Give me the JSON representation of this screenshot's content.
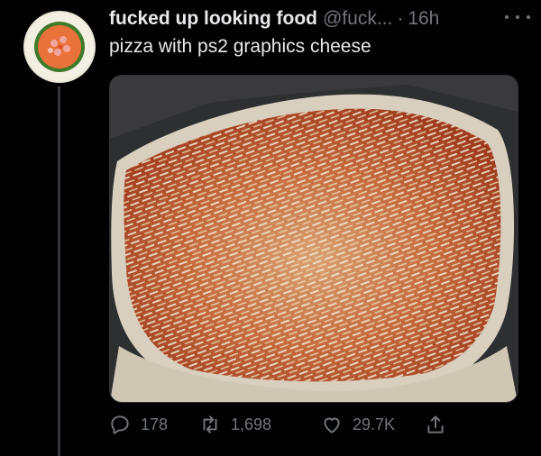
{
  "tweet": {
    "display_name": "fucked up looking food",
    "handle": "@fuck...",
    "separator": "·",
    "time": "16h",
    "text": "pizza with ps2 graphics cheese",
    "more_icon": "ellipsis-icon",
    "avatar_image": "plate-of-food",
    "media_image": "pizza-photo"
  },
  "actions": {
    "replies": "178",
    "retweets": "1,698",
    "likes": "29.7K",
    "reply_icon": "reply-icon",
    "retweet_icon": "retweet-icon",
    "like_icon": "heart-icon",
    "share_icon": "share-icon"
  },
  "colors": {
    "background": "#000000",
    "primary_text": "#e7e9ea",
    "secondary_text": "#71767b",
    "thread_line": "#333639"
  }
}
